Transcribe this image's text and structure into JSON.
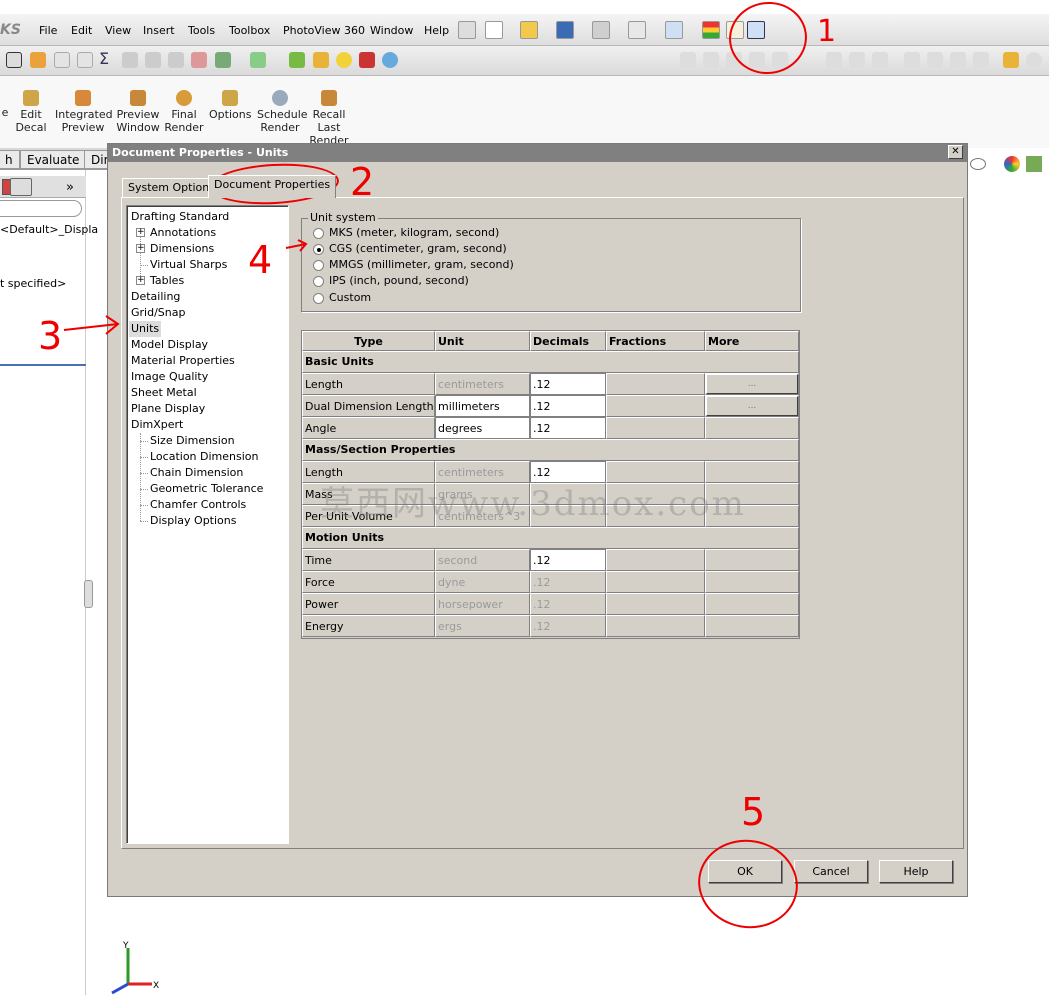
{
  "app": {
    "logo": "KS",
    "menu": [
      "File",
      "Edit",
      "View",
      "Insert",
      "Tools",
      "Toolbox",
      "PhotoView 360",
      "Window",
      "Help"
    ]
  },
  "ribbon": {
    "buttons": [
      {
        "label": "Edit\nDecal",
        "icon": "decal-icon"
      },
      {
        "label": "Integrated\nPreview",
        "icon": "integrated-preview-icon"
      },
      {
        "label": "Preview\nWindow",
        "icon": "preview-window-icon"
      },
      {
        "label": "Final\nRender",
        "icon": "final-render-icon"
      },
      {
        "label": "Options",
        "icon": "options-icon"
      },
      {
        "label": "Schedule\nRender",
        "icon": "schedule-render-icon"
      },
      {
        "label": "Recall\nLast\nRender",
        "icon": "recall-last-render-icon"
      }
    ],
    "cut_label_left": "e"
  },
  "command_tabs": [
    "h",
    "Evaluate",
    "Dim"
  ],
  "left_panel": {
    "config_text": "<Default>_Displa",
    "spec_text": "t specified>",
    "chevron": "»"
  },
  "dialog": {
    "title": "Document Properties - Units",
    "close": "✕",
    "tabs": [
      "System Options",
      "Document Properties"
    ],
    "tree": [
      {
        "label": "Drafting Standard",
        "level": 0
      },
      {
        "label": "Annotations",
        "level": 1,
        "expander": "+"
      },
      {
        "label": "Dimensions",
        "level": 1,
        "expander": "+"
      },
      {
        "label": "Virtual Sharps",
        "level": 1
      },
      {
        "label": "Tables",
        "level": 1,
        "expander": "+"
      },
      {
        "label": "Detailing",
        "level": 0
      },
      {
        "label": "Grid/Snap",
        "level": 0
      },
      {
        "label": "Units",
        "level": 0,
        "selected": true
      },
      {
        "label": "Model Display",
        "level": 0
      },
      {
        "label": "Material Properties",
        "level": 0
      },
      {
        "label": "Image Quality",
        "level": 0
      },
      {
        "label": "Sheet Metal",
        "level": 0
      },
      {
        "label": "Plane Display",
        "level": 0
      },
      {
        "label": "DimXpert",
        "level": 0
      },
      {
        "label": "Size Dimension",
        "level": 1
      },
      {
        "label": "Location Dimension",
        "level": 1
      },
      {
        "label": "Chain Dimension",
        "level": 1
      },
      {
        "label": "Geometric Tolerance",
        "level": 1
      },
      {
        "label": "Chamfer Controls",
        "level": 1
      },
      {
        "label": "Display Options",
        "level": 1
      }
    ],
    "unit_system": {
      "legend": "Unit system",
      "options": [
        {
          "label": "MKS  (meter, kilogram, second)",
          "selected": false
        },
        {
          "label": "CGS  (centimeter, gram, second)",
          "selected": true
        },
        {
          "label": "MMGS  (millimeter, gram, second)",
          "selected": false
        },
        {
          "label": "IPS  (inch, pound, second)",
          "selected": false
        },
        {
          "label": "Custom",
          "selected": false
        }
      ]
    },
    "table": {
      "headers": [
        "Type",
        "Unit",
        "Decimals",
        "Fractions",
        "More"
      ],
      "sections": [
        {
          "title": "Basic Units",
          "rows": [
            {
              "type": "Length",
              "unit": "centimeters",
              "decimals": ".12",
              "unit_editable": false,
              "dec_editable": true,
              "more": "..."
            },
            {
              "type": "Dual Dimension Length",
              "unit": "millimeters",
              "decimals": ".12",
              "unit_editable": true,
              "dec_editable": true,
              "more": "..."
            },
            {
              "type": "Angle",
              "unit": "degrees",
              "decimals": ".12",
              "unit_editable": true,
              "dec_editable": true,
              "more": ""
            }
          ]
        },
        {
          "title": "Mass/Section Properties",
          "rows": [
            {
              "type": "Length",
              "unit": "centimeters",
              "decimals": ".12",
              "unit_editable": false,
              "dec_editable": true,
              "more": ""
            },
            {
              "type": "Mass",
              "unit": "grams",
              "decimals": "",
              "unit_editable": false,
              "dec_editable": false,
              "more": ""
            },
            {
              "type": "Per Unit Volume",
              "unit": "centimeters^3",
              "decimals": "",
              "unit_editable": false,
              "dec_editable": false,
              "more": ""
            }
          ]
        },
        {
          "title": "Motion Units",
          "rows": [
            {
              "type": "Time",
              "unit": "second",
              "decimals": ".12",
              "unit_editable": false,
              "dec_editable": true,
              "more": ""
            },
            {
              "type": "Force",
              "unit": "dyne",
              "decimals": ".12",
              "unit_editable": false,
              "dec_editable": false,
              "more": ""
            },
            {
              "type": "Power",
              "unit": "horsepower",
              "decimals": ".12",
              "unit_editable": false,
              "dec_editable": false,
              "more": ""
            },
            {
              "type": "Energy",
              "unit": "ergs",
              "decimals": ".12",
              "unit_editable": false,
              "dec_editable": false,
              "more": ""
            }
          ]
        }
      ]
    },
    "buttons": {
      "ok": "OK",
      "cancel": "Cancel",
      "help": "Help"
    }
  },
  "watermark": "莫西网www.3dmox.com",
  "annotations": [
    "1",
    "2",
    "3",
    "4",
    "5"
  ],
  "axis": {
    "x": "X",
    "y": "Y"
  },
  "colors": {
    "annotation": "#e00000",
    "dialog_bg": "#d4d0c8",
    "title_bar": "#808080"
  }
}
